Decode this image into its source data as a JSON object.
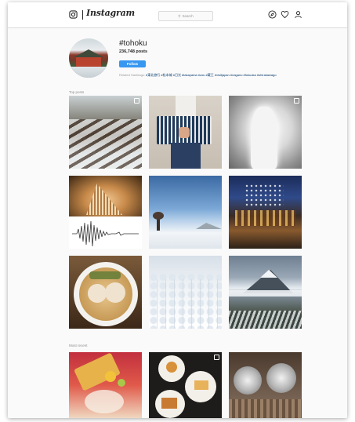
{
  "nav": {
    "logo": "Instagram",
    "search_placeholder": "Search",
    "icons": [
      "camera-icon",
      "compass-icon",
      "heart-icon",
      "user-icon"
    ]
  },
  "profile": {
    "hashtag": "#tohoku",
    "posts": "236,748 posts",
    "follow_label": "Follow",
    "related_label": "Related Hashtags:",
    "related_tags": "#東北旅行 #松本城 #日光 #takayama #zou #蔵王 #visitjapan #nagano #fukuoka #shirakawago"
  },
  "sections": {
    "top_posts": "Top posts",
    "most_recent": "Most recent"
  },
  "colors": {
    "accent": "#3897f0",
    "background": "#fafafa",
    "text": "#262626"
  }
}
